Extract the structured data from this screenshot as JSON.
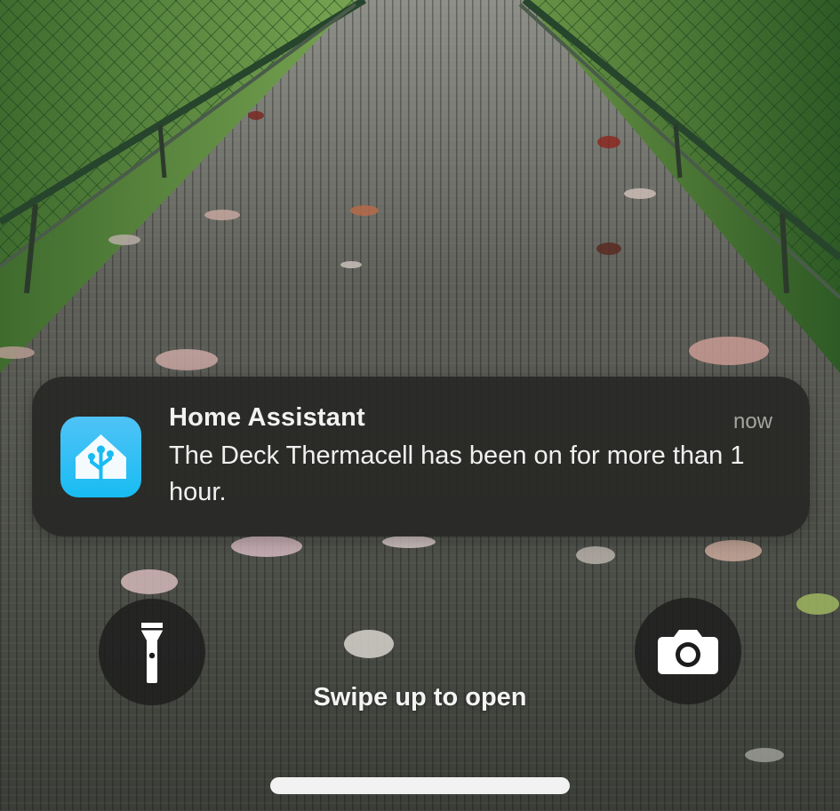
{
  "notification": {
    "app_name": "Home Assistant",
    "time": "now",
    "message": "The Deck Thermacell has been on for more than 1 hour.",
    "app_icon": "home-assistant-icon",
    "icon_color": "#18bcf2"
  },
  "lock_screen": {
    "swipe_hint": "Swipe up to open",
    "left_action_icon": "flashlight-icon",
    "right_action_icon": "camera-icon"
  },
  "colors": {
    "notification_bg": "#282826",
    "text_primary": "#f0f0f0",
    "text_secondary": "#a4a4a0"
  }
}
